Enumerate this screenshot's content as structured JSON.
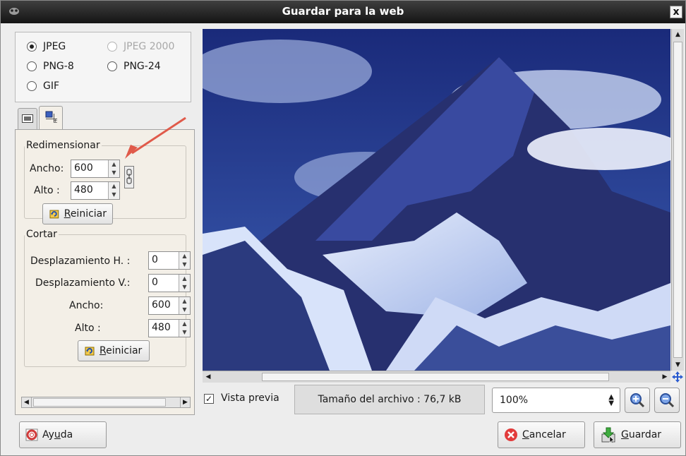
{
  "window": {
    "title": "Guardar para la web",
    "close_label": "x"
  },
  "formats": [
    {
      "label": "JPEG",
      "selected": true,
      "enabled": true
    },
    {
      "label": "JPEG 2000",
      "selected": false,
      "enabled": false
    },
    {
      "label": "PNG-8",
      "selected": false,
      "enabled": true
    },
    {
      "label": "PNG-24",
      "selected": false,
      "enabled": true
    },
    {
      "label": "GIF",
      "selected": false,
      "enabled": true
    }
  ],
  "resize": {
    "legend": "Redimensionar",
    "width_label": "Ancho:",
    "width_value": "600",
    "height_label": "Alto :",
    "height_value": "480",
    "reset_prefix": "",
    "reset_mnemonic": "R",
    "reset_rest": "einiciar"
  },
  "crop": {
    "legend": "Cortar",
    "offset_h_label": "Desplazamiento H. :",
    "offset_h_value": "0",
    "offset_v_label": "Desplazamiento V.:",
    "offset_v_value": "0",
    "width_label": "Ancho:",
    "width_value": "600",
    "height_label": "Alto :",
    "height_value": "480",
    "reset_prefix": "",
    "reset_mnemonic": "R",
    "reset_rest": "einiciar"
  },
  "preview": {
    "label": "Vista previa",
    "checked": true
  },
  "file_size": "Tamaño del archivo : 76,7 kB",
  "zoom": "100%",
  "buttons": {
    "help_pre": "Ay",
    "help_mn": "u",
    "help_post": "da",
    "cancel_pre": "",
    "cancel_mn": "C",
    "cancel_post": "ancelar",
    "save_pre": "",
    "save_mn": "G",
    "save_post": "uardar"
  },
  "colors": {
    "accent_red": "#e23b3b",
    "arrow": "#e05a4a",
    "title_bg": "#1f1f1f"
  },
  "icons": [
    "app-icon",
    "close-icon",
    "image-tab-icon",
    "resize-tab-icon",
    "chain-link-icon",
    "reset-icon",
    "help-icon",
    "cancel-icon",
    "save-icon",
    "zoom-in-icon",
    "zoom-out-icon",
    "move-icon"
  ]
}
